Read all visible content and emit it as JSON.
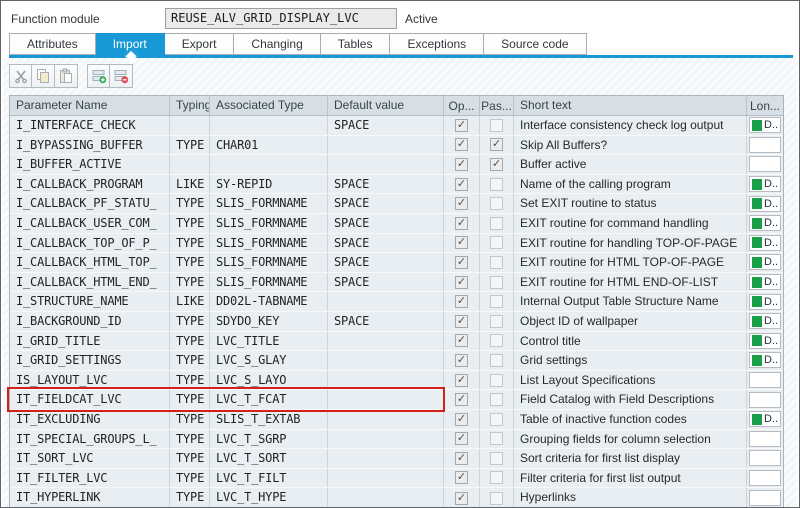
{
  "header": {
    "label": "Function module",
    "value": "REUSE_ALV_GRID_DISPLAY_LVC",
    "status": "Active"
  },
  "tabs": [
    {
      "label": "Attributes",
      "selected": false
    },
    {
      "label": "Import",
      "selected": true
    },
    {
      "label": "Export",
      "selected": false
    },
    {
      "label": "Changing",
      "selected": false
    },
    {
      "label": "Tables",
      "selected": false
    },
    {
      "label": "Exceptions",
      "selected": false
    },
    {
      "label": "Source code",
      "selected": false
    }
  ],
  "toolbar": {
    "icons": [
      "cut-icon",
      "copy-icon",
      "paste-icon",
      "insert-line-icon",
      "delete-line-icon"
    ]
  },
  "table": {
    "columns": [
      "Parameter Name",
      "Typing",
      "Associated Type",
      "Default value",
      "Op...",
      "Pas...",
      "Short text",
      "Lon..."
    ],
    "long_text_label": "D..",
    "rows": [
      {
        "param": "I_INTERFACE_CHECK",
        "typing": "",
        "type": "",
        "default": "SPACE",
        "optional": true,
        "pass_value": false,
        "short_text": "Interface consistency check log output",
        "long_text": true,
        "highlighted": false
      },
      {
        "param": "I_BYPASSING_BUFFER",
        "typing": "TYPE",
        "type": "CHAR01",
        "default": "",
        "optional": true,
        "pass_value": true,
        "short_text": "Skip All Buffers?",
        "long_text": false,
        "highlighted": false
      },
      {
        "param": "I_BUFFER_ACTIVE",
        "typing": "",
        "type": "",
        "default": "",
        "optional": true,
        "pass_value": true,
        "short_text": "Buffer active",
        "long_text": false,
        "highlighted": false
      },
      {
        "param": "I_CALLBACK_PROGRAM",
        "typing": "LIKE",
        "type": "SY-REPID",
        "default": "SPACE",
        "optional": true,
        "pass_value": false,
        "short_text": "Name of the calling program",
        "long_text": true,
        "highlighted": false
      },
      {
        "param": "I_CALLBACK_PF_STATU_",
        "typing": "TYPE",
        "type": "SLIS_FORMNAME",
        "default": "SPACE",
        "optional": true,
        "pass_value": false,
        "short_text": "Set EXIT routine to status",
        "long_text": true,
        "highlighted": false
      },
      {
        "param": "I_CALLBACK_USER_COM_",
        "typing": "TYPE",
        "type": "SLIS_FORMNAME",
        "default": "SPACE",
        "optional": true,
        "pass_value": false,
        "short_text": "EXIT routine for command handling",
        "long_text": true,
        "highlighted": false
      },
      {
        "param": "I_CALLBACK_TOP_OF_P_",
        "typing": "TYPE",
        "type": "SLIS_FORMNAME",
        "default": "SPACE",
        "optional": true,
        "pass_value": false,
        "short_text": "EXIT routine for handling TOP-OF-PAGE",
        "long_text": true,
        "highlighted": false
      },
      {
        "param": "I_CALLBACK_HTML_TOP_",
        "typing": "TYPE",
        "type": "SLIS_FORMNAME",
        "default": "SPACE",
        "optional": true,
        "pass_value": false,
        "short_text": "EXIT routine for HTML TOP-OF-PAGE",
        "long_text": true,
        "highlighted": false
      },
      {
        "param": "I_CALLBACK_HTML_END_",
        "typing": "TYPE",
        "type": "SLIS_FORMNAME",
        "default": "SPACE",
        "optional": true,
        "pass_value": false,
        "short_text": "EXIT routine for HTML END-OF-LIST",
        "long_text": true,
        "highlighted": false
      },
      {
        "param": "I_STRUCTURE_NAME",
        "typing": "LIKE",
        "type": "DD02L-TABNAME",
        "default": "",
        "optional": true,
        "pass_value": false,
        "short_text": "Internal Output Table Structure Name",
        "long_text": true,
        "highlighted": false
      },
      {
        "param": "I_BACKGROUND_ID",
        "typing": "TYPE",
        "type": "SDYDO_KEY",
        "default": "SPACE",
        "optional": true,
        "pass_value": false,
        "short_text": "Object ID of wallpaper",
        "long_text": true,
        "highlighted": false
      },
      {
        "param": "I_GRID_TITLE",
        "typing": "TYPE",
        "type": "LVC_TITLE",
        "default": "",
        "optional": true,
        "pass_value": false,
        "short_text": "Control title",
        "long_text": true,
        "highlighted": false
      },
      {
        "param": "I_GRID_SETTINGS",
        "typing": "TYPE",
        "type": "LVC_S_GLAY",
        "default": "",
        "optional": true,
        "pass_value": false,
        "short_text": "Grid settings",
        "long_text": true,
        "highlighted": false
      },
      {
        "param": "IS_LAYOUT_LVC",
        "typing": "TYPE",
        "type": "LVC_S_LAYO",
        "default": "",
        "optional": true,
        "pass_value": false,
        "short_text": "List Layout Specifications",
        "long_text": false,
        "highlighted": false
      },
      {
        "param": "IT_FIELDCAT_LVC",
        "typing": "TYPE",
        "type": "LVC_T_FCAT",
        "default": "",
        "optional": true,
        "pass_value": false,
        "short_text": "Field Catalog with Field Descriptions",
        "long_text": false,
        "highlighted": true
      },
      {
        "param": "IT_EXCLUDING",
        "typing": "TYPE",
        "type": "SLIS_T_EXTAB",
        "default": "",
        "optional": true,
        "pass_value": false,
        "short_text": "Table of inactive function codes",
        "long_text": true,
        "highlighted": false
      },
      {
        "param": "IT_SPECIAL_GROUPS_L_",
        "typing": "TYPE",
        "type": "LVC_T_SGRP",
        "default": "",
        "optional": true,
        "pass_value": false,
        "short_text": "Grouping fields for column selection",
        "long_text": false,
        "highlighted": false
      },
      {
        "param": "IT_SORT_LVC",
        "typing": "TYPE",
        "type": "LVC_T_SORT",
        "default": "",
        "optional": true,
        "pass_value": false,
        "short_text": "Sort criteria for first list display",
        "long_text": false,
        "highlighted": false
      },
      {
        "param": "IT_FILTER_LVC",
        "typing": "TYPE",
        "type": "LVC_T_FILT",
        "default": "",
        "optional": true,
        "pass_value": false,
        "short_text": "Filter criteria for first list output",
        "long_text": false,
        "highlighted": false
      },
      {
        "param": "IT_HYPERLINK",
        "typing": "TYPE",
        "type": "LVC_T_HYPE",
        "default": "",
        "optional": true,
        "pass_value": false,
        "short_text": "Hyperlinks",
        "long_text": false,
        "highlighted": false
      }
    ]
  },
  "colors": {
    "accent_blue": "#1899d6",
    "selection_red": "#d42019",
    "long_text_green": "#18a048"
  }
}
